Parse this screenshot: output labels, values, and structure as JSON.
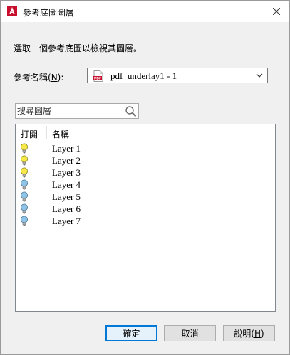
{
  "window": {
    "title": "參考底圖圖層"
  },
  "instruction": "選取一個參考底圖以檢視其圖層。",
  "reference": {
    "label_prefix": "參考名稱(",
    "label_mnemonic": "N",
    "label_suffix": "):",
    "selected": "pdf_underlay1 - 1"
  },
  "search": {
    "placeholder": "搜尋圖層",
    "value": ""
  },
  "layer_list": {
    "columns": {
      "on": "打開",
      "name": "名稱"
    },
    "layers": [
      {
        "name": "Layer 1",
        "on": true
      },
      {
        "name": "Layer 2",
        "on": true
      },
      {
        "name": "Layer 3",
        "on": true
      },
      {
        "name": "Layer 4",
        "on": false
      },
      {
        "name": "Layer 5",
        "on": false
      },
      {
        "name": "Layer 6",
        "on": false
      },
      {
        "name": "Layer 7",
        "on": false
      }
    ]
  },
  "buttons": {
    "ok": "確定",
    "cancel": "取消",
    "help_prefix": "說明(",
    "help_mnemonic": "H",
    "help_suffix": ")"
  },
  "colors": {
    "bulb_on": "#f7e84a",
    "bulb_off": "#8fc4e6",
    "accent": "#0078d7"
  }
}
